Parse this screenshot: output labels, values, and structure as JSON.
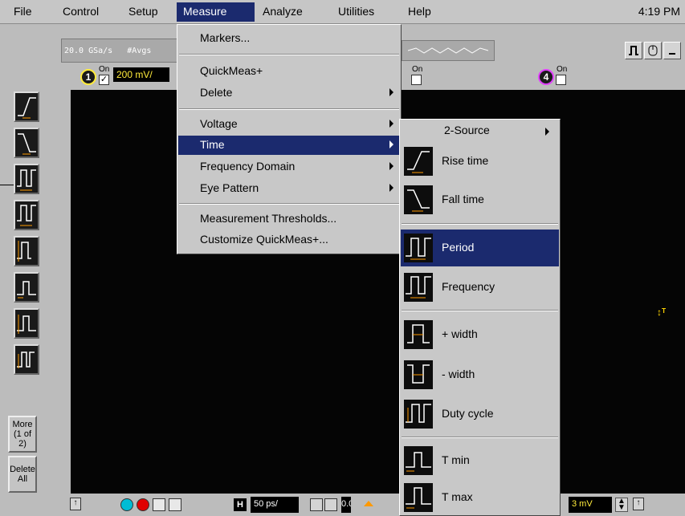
{
  "menubar": {
    "items": [
      "File",
      "Control",
      "Setup",
      "Measure",
      "Analyze",
      "Utilities",
      "Help"
    ],
    "active": "Measure",
    "clock": "4:19 PM"
  },
  "status": {
    "sample_rate": "20.0 GSa/s",
    "averages_label": "#Avgs"
  },
  "channels": {
    "ch1": {
      "number": "1",
      "on_label": "On",
      "checked": true,
      "scale": "200 mV/"
    },
    "ch3": {
      "on_label": "On"
    },
    "ch4": {
      "number": "4",
      "on_label": "On"
    }
  },
  "left_toolbar": {
    "tools": [
      "rise-time",
      "fall-time",
      "period",
      "frequency",
      "plus-width",
      "t-min",
      "t-max",
      "duty-cycle"
    ],
    "more_button": [
      "More",
      "(1 of 2)"
    ],
    "delete_button": [
      "Delete",
      "All"
    ]
  },
  "measure_menu": {
    "items": [
      {
        "label": "Markers...",
        "submenu": false
      },
      {
        "label": "QuickMeas+",
        "submenu": false
      },
      {
        "label": "Delete",
        "submenu": true
      },
      {
        "label": "Voltage",
        "submenu": true
      },
      {
        "label": "Time",
        "submenu": true,
        "highlighted": true
      },
      {
        "label": "Frequency Domain",
        "submenu": true
      },
      {
        "label": "Eye Pattern",
        "submenu": true
      },
      {
        "label": "Measurement Thresholds...",
        "submenu": false
      },
      {
        "label": "Customize QuickMeas+...",
        "submenu": false
      }
    ]
  },
  "time_menu": {
    "two_source": "2-Source",
    "items": [
      {
        "label": "Rise time",
        "icon": "rise-time-icon"
      },
      {
        "label": "Fall time",
        "icon": "fall-time-icon"
      },
      {
        "label": "Period",
        "icon": "period-icon",
        "highlighted": true
      },
      {
        "label": "Frequency",
        "icon": "frequency-icon"
      },
      {
        "label": "+ width",
        "icon": "plus-width-icon"
      },
      {
        "label": "- width",
        "icon": "minus-width-icon"
      },
      {
        "label": "Duty cycle",
        "icon": "duty-cycle-icon"
      },
      {
        "label": "T min",
        "icon": "t-min-icon"
      },
      {
        "label": "T max",
        "icon": "t-max-icon"
      }
    ]
  },
  "bottom_bar": {
    "h_label": "H",
    "timebase": "50 ps/",
    "value_partial": "0.0",
    "trigger_level": "3 mV"
  },
  "colors": {
    "highlight": "#1b2a6e",
    "screen": "#050505",
    "trace_yellow": "#ffeb3b",
    "marker_orange": "#ff9900"
  }
}
